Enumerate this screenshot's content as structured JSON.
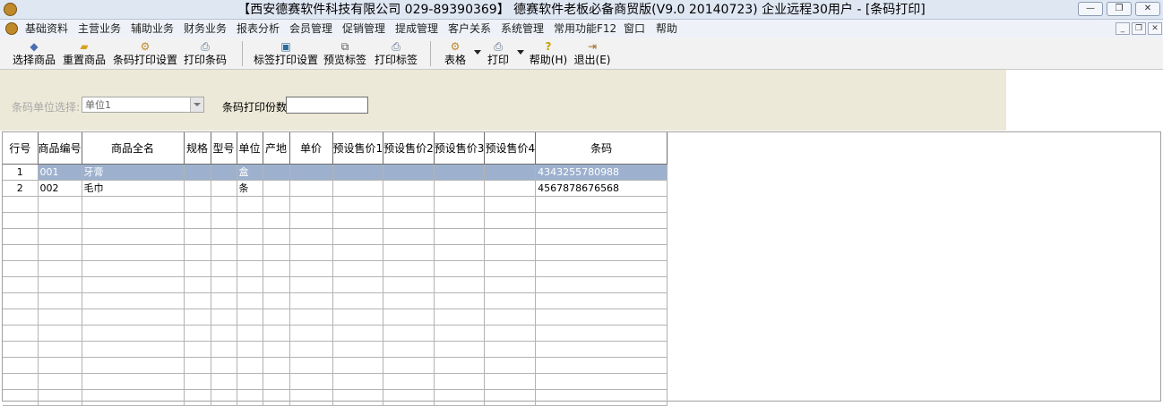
{
  "window": {
    "title": "【西安德赛软件科技有限公司 029-89390369】 德赛软件老板必备商贸版(V9.0 20140723) 企业远程30用户 - [条码打印]"
  },
  "menu": {
    "items": [
      "基础资料",
      "主营业务",
      "辅助业务",
      "财务业务",
      "报表分析",
      "会员管理",
      "促销管理",
      "提成管理",
      "客户关系",
      "系统管理",
      "常用功能F12",
      "窗口",
      "帮助"
    ]
  },
  "toolbar": {
    "select_goods": "选择商品",
    "reset_goods": "重置商品",
    "barcode_print_settings": "条码打印设置",
    "print_barcode": "打印条码",
    "label_print_settings": "标签打印设置",
    "preview_label": "预览标签",
    "print_label": "打印标签",
    "table": "表格",
    "print": "打印",
    "help": "帮助(H)",
    "exit": "退出(E)"
  },
  "filter": {
    "unit_label": "条码单位选择:",
    "unit_value": "单位1",
    "copies_label": "条码打印份数",
    "copies_value": ""
  },
  "grid": {
    "columns": [
      "行号",
      "商品编号",
      "商品全名",
      "规格",
      "型号",
      "单位",
      "产地",
      "单价",
      "预设售价1",
      "预设售价2",
      "预设售价3",
      "预设售价4",
      "条码"
    ],
    "rows": [
      [
        "1",
        "001",
        "牙膏",
        "",
        "",
        "盒",
        "",
        "",
        "",
        "",
        "",
        "",
        "4343255780988"
      ],
      [
        "2",
        "002",
        "毛巾",
        "",
        "",
        "条",
        "",
        "",
        "",
        "",
        "",
        "",
        "4567878676568"
      ]
    ],
    "selected_row": 1,
    "empty_rows": 13
  },
  "colors": {
    "selected_row": "#9db1cf",
    "filter_panel": "#ece9d8",
    "title_bar": "#dfe7f3"
  }
}
